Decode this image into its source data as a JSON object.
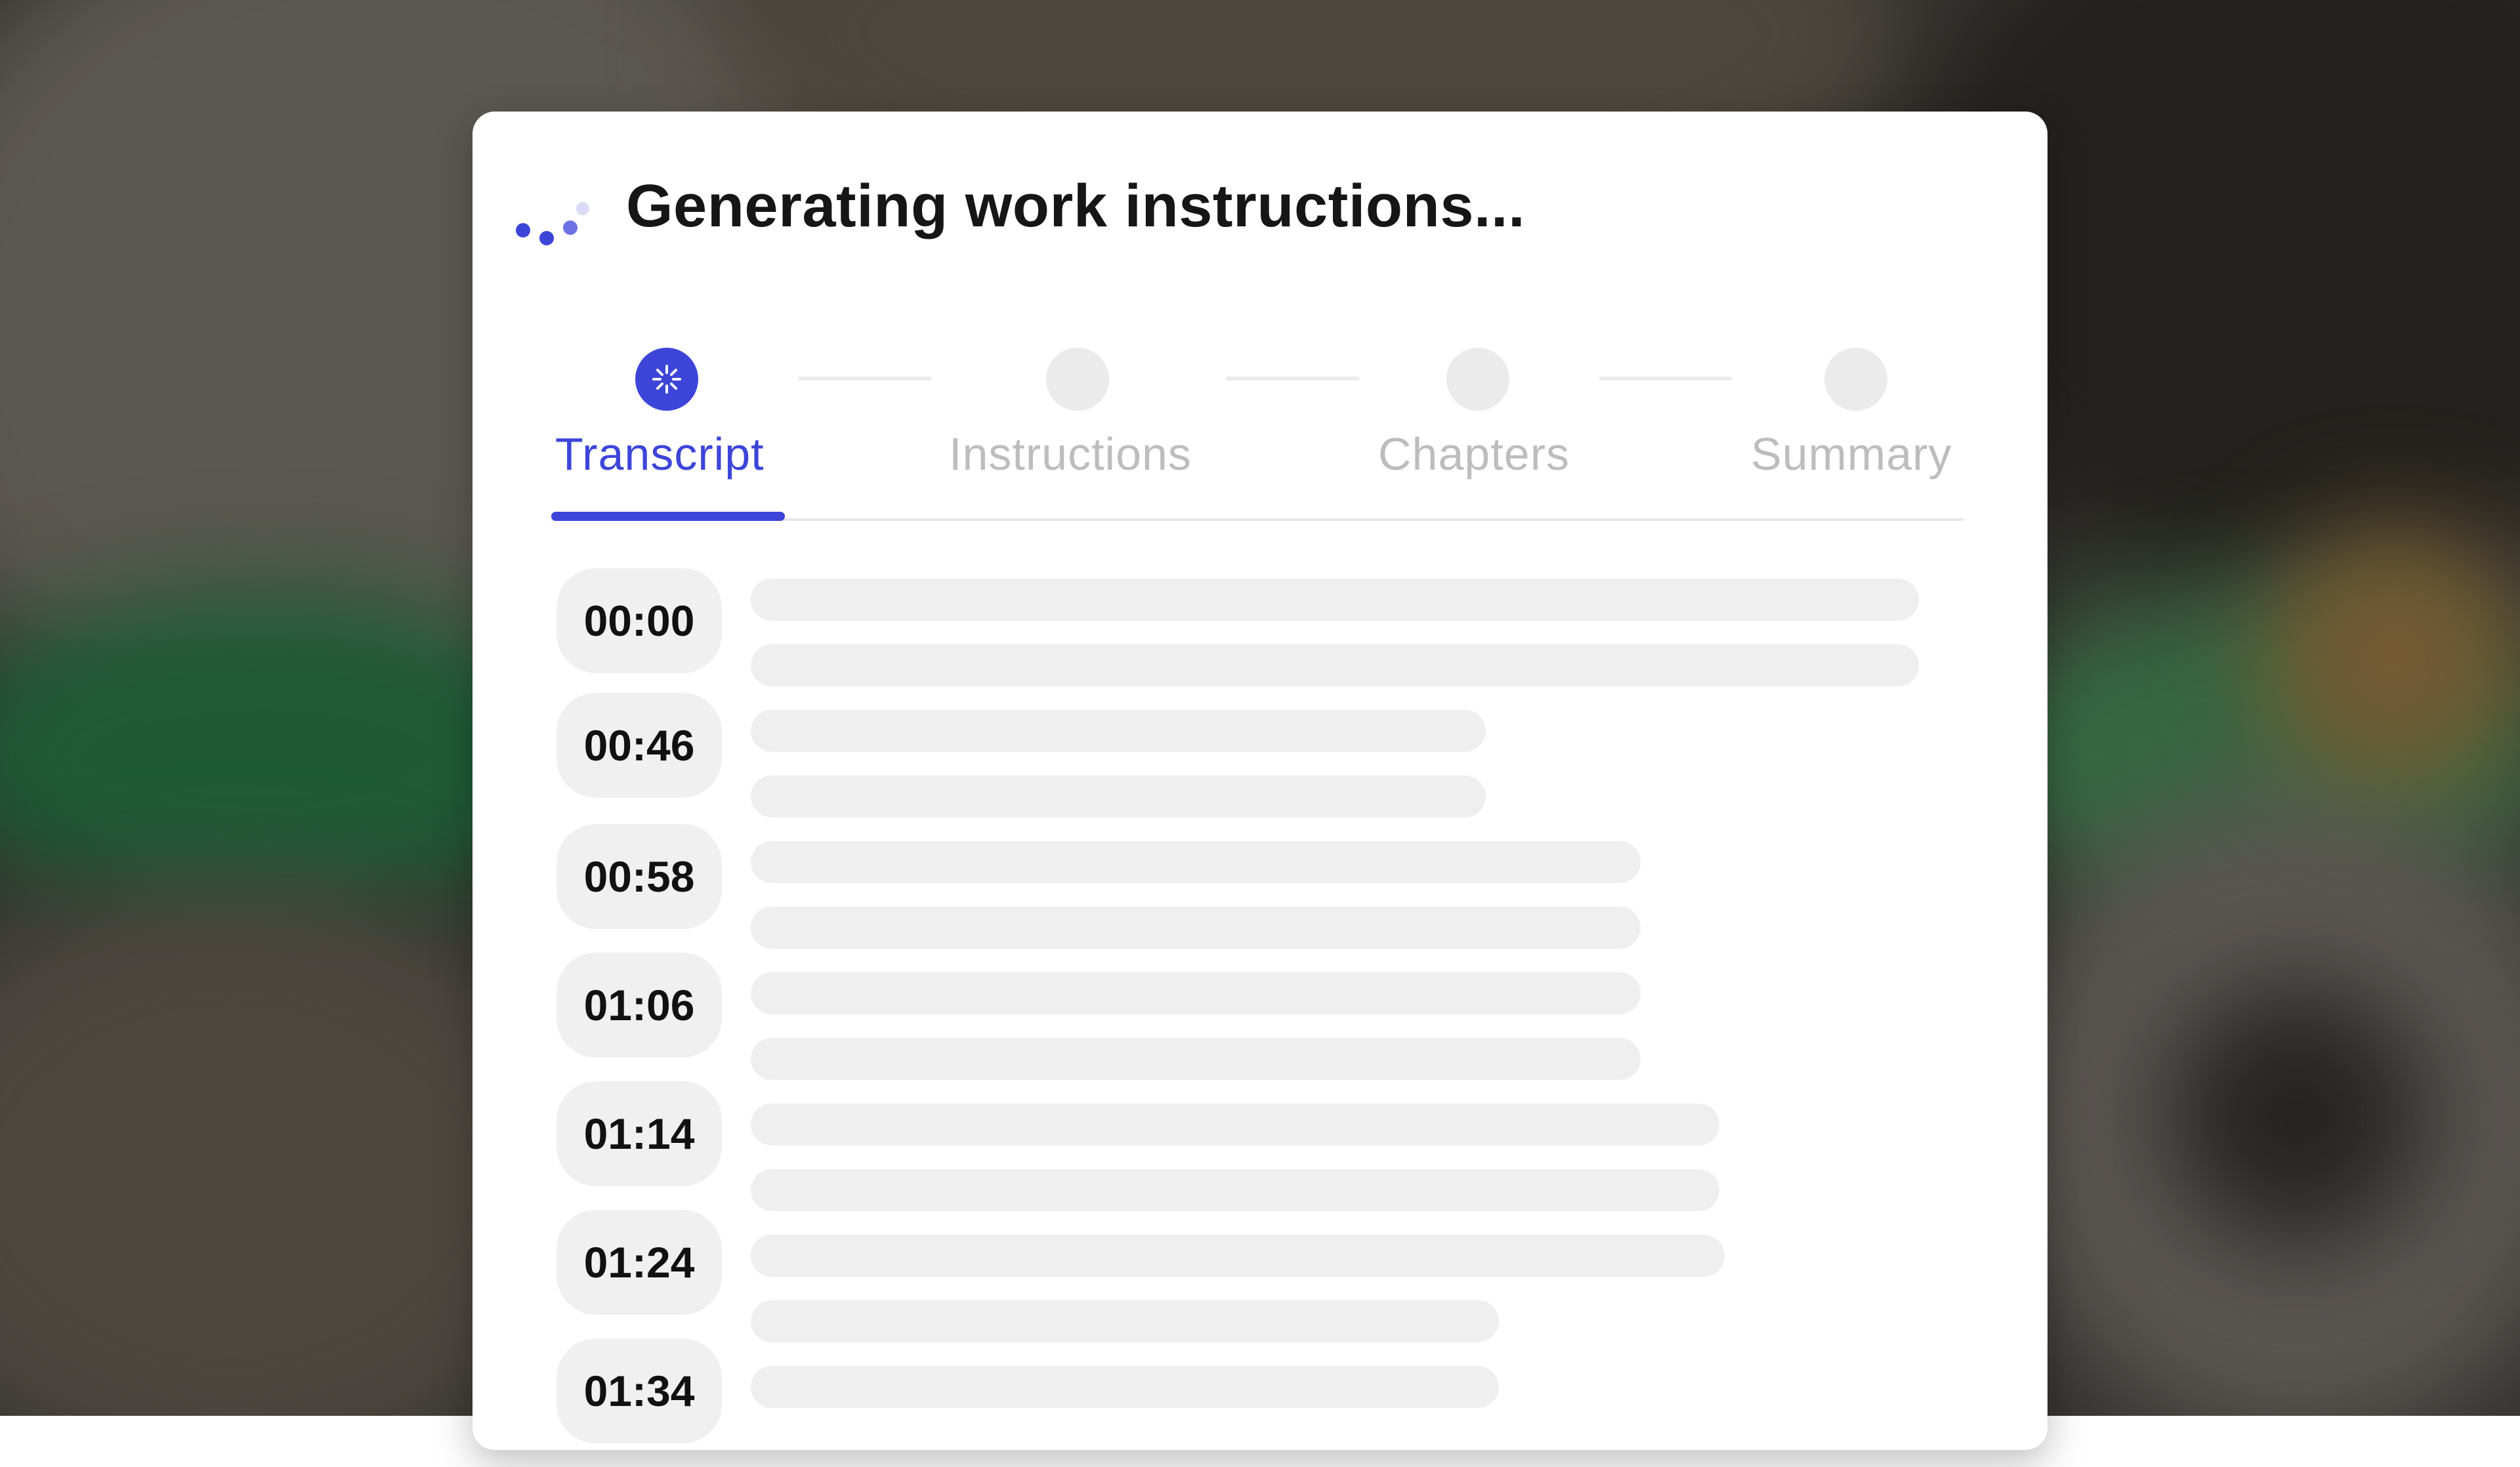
{
  "title": "Generating work instructions...",
  "accent_color": "#3d45d9",
  "loader_icon": "three-dot-spinner-icon",
  "steps": [
    {
      "label": "Transcript",
      "state": "active",
      "icon": "spinner-icon"
    },
    {
      "label": "Instructions",
      "state": "pending"
    },
    {
      "label": "Chapters",
      "state": "pending"
    },
    {
      "label": "Summary",
      "state": "pending"
    }
  ],
  "active_tab": "Transcript",
  "transcript": {
    "loading": true,
    "rows": [
      {
        "time": "00:00"
      },
      {
        "time": "00:46"
      },
      {
        "time": "00:58"
      },
      {
        "time": "01:06"
      },
      {
        "time": "01:14"
      },
      {
        "time": "01:24"
      },
      {
        "time": "01:34"
      }
    ]
  }
}
